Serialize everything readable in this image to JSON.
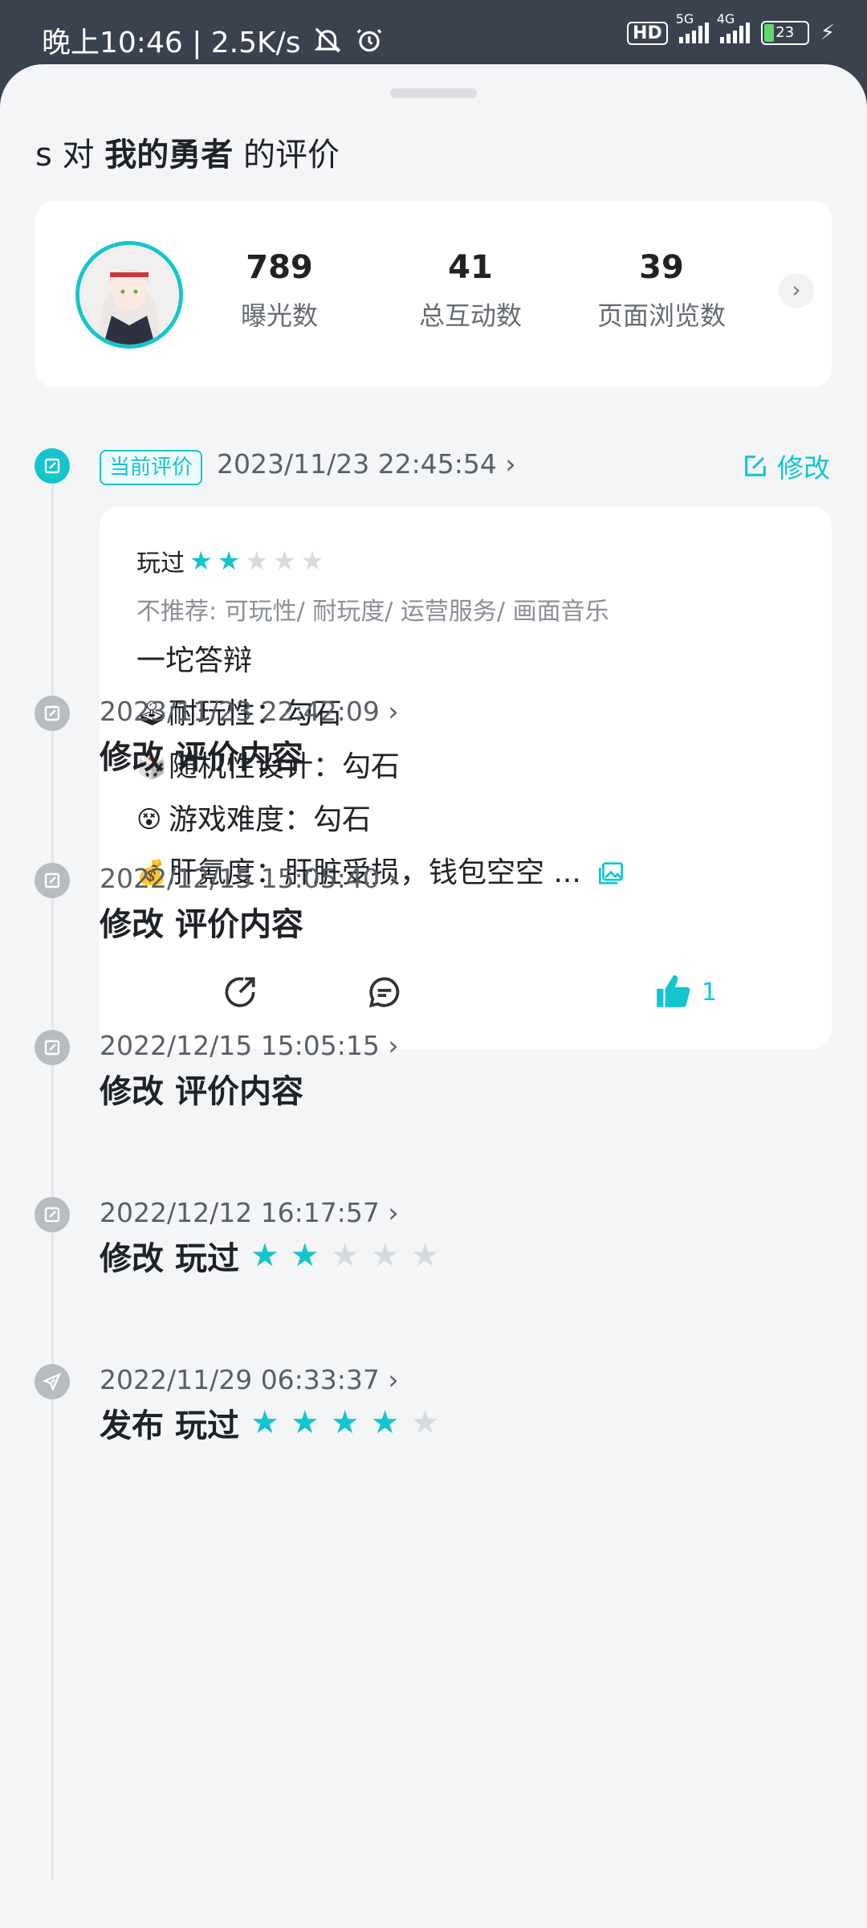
{
  "status_bar": {
    "left_text": "晚上10:46 | 2.5K/s",
    "hd_label": "HD",
    "net1": "5G",
    "net2": "4G",
    "battery": "23"
  },
  "page": {
    "title_prefix": "s 对",
    "title_game": "我的勇者",
    "title_suffix": "的评价"
  },
  "stats": {
    "exposure": {
      "value": "789",
      "label": "曝光数"
    },
    "interactions": {
      "value": "41",
      "label": "总互动数"
    },
    "page_views": {
      "value": "39",
      "label": "页面浏览数"
    }
  },
  "current_review": {
    "tag": "当前评价",
    "time": "2023/11/23 22:45:54 ›",
    "edit_label": "修改",
    "played_label": "玩过",
    "rating": 2,
    "not_recommend": "不推荐: 可玩性/ 耐玩度/ 运营服务/ 画面音乐",
    "line1": "一坨答辩",
    "line2_emoji": "🕹",
    "line2": "耐玩性：勾石",
    "line3_emoji": "🎲",
    "line3": "随机性设计：勾石",
    "line4_emoji": "😵",
    "line4": "游戏难度：勾石",
    "line5_emoji": "💰",
    "line5": "肝氪度：肝脏受损，钱包空空 ...",
    "like_count": "1"
  },
  "history": [
    {
      "time": "2023/11/23 22:42:09 ›",
      "action": "修改",
      "content": "评价内容"
    },
    {
      "time": "2022/12/15 15:05:40 ›",
      "action": "修改",
      "content": "评价内容"
    },
    {
      "time": "2022/12/15 15:05:15 ›",
      "action": "修改",
      "content": "评价内容"
    },
    {
      "time": "2022/12/12 16:17:57 ›",
      "action": "修改",
      "content": "玩过",
      "rating": 2
    },
    {
      "time": "2022/11/29 06:33:37 ›",
      "action": "发布",
      "content": "玩过",
      "rating": 4
    }
  ],
  "colors": {
    "accent": "#15c5ce",
    "muted": "#b8bcc2"
  }
}
